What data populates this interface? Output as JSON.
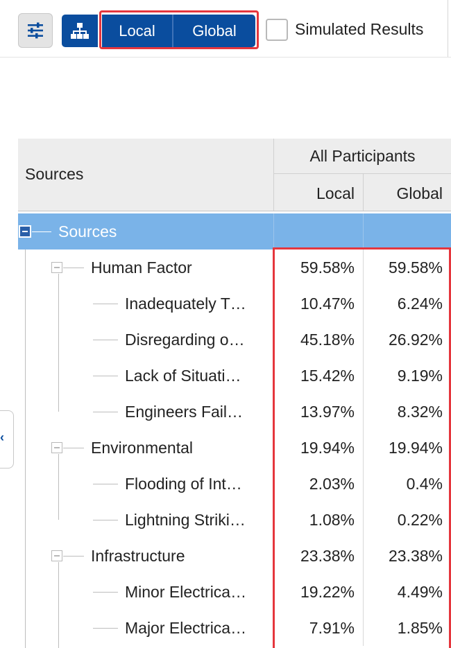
{
  "toolbar": {
    "settings_icon": "sliders-icon",
    "hierarchy_icon": "hierarchy-icon",
    "local_label": "Local",
    "global_label": "Global",
    "simulated_label": "Simulated Results",
    "simulated_checked": false,
    "accent_color": "#0a4d9e",
    "highlight_color": "#e5363d"
  },
  "grid": {
    "sources_header": "Sources",
    "group_header": "All Participants",
    "local_header": "Local",
    "global_header": "Global",
    "rows": [
      {
        "name": "Sources",
        "level": 0,
        "local": "",
        "global": ""
      },
      {
        "name": "Human Factor",
        "level": 1,
        "local": "59.58%",
        "global": "59.58%"
      },
      {
        "name": "Inadequately T…",
        "level": 2,
        "local": "10.47%",
        "global": "6.24%"
      },
      {
        "name": "Disregarding o…",
        "level": 2,
        "local": "45.18%",
        "global": "26.92%"
      },
      {
        "name": "Lack of Situati…",
        "level": 2,
        "local": "15.42%",
        "global": "9.19%"
      },
      {
        "name": "Engineers Fail…",
        "level": 2,
        "local": "13.97%",
        "global": "8.32%"
      },
      {
        "name": "Environmental",
        "level": 1,
        "local": "19.94%",
        "global": "19.94%"
      },
      {
        "name": "Flooding of Int…",
        "level": 2,
        "local": "2.03%",
        "global": "0.4%"
      },
      {
        "name": "Lightning Striki…",
        "level": 2,
        "local": "1.08%",
        "global": "0.22%"
      },
      {
        "name": "Infrastructure",
        "level": 1,
        "local": "23.38%",
        "global": "23.38%"
      },
      {
        "name": "Minor Electrica…",
        "level": 2,
        "local": "19.22%",
        "global": "4.49%"
      },
      {
        "name": "Major Electrica…",
        "level": 2,
        "local": "7.91%",
        "global": "1.85%"
      }
    ]
  },
  "sidebar": {
    "collapse_icon": "chevron-left-icon"
  }
}
